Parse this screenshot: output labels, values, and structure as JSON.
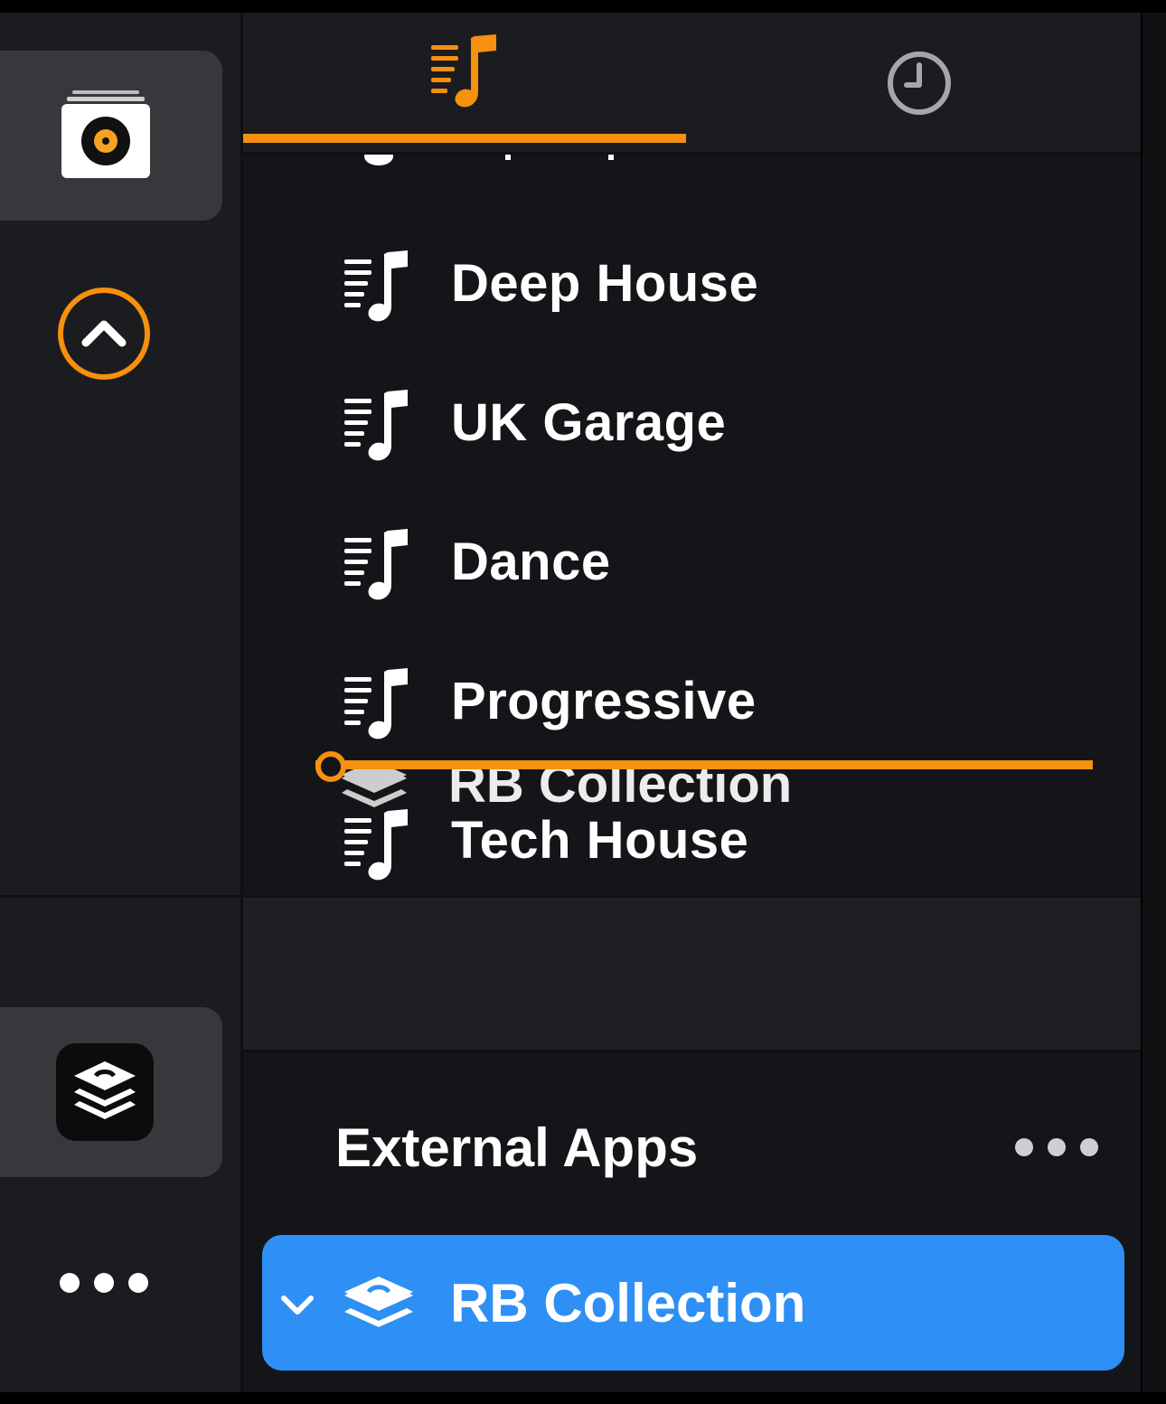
{
  "tabs": [
    {
      "name": "playlists",
      "icon": "playlist-icon",
      "active": true
    },
    {
      "name": "history",
      "icon": "clock-icon",
      "active": false
    }
  ],
  "playlists": {
    "items": [
      {
        "label": "Deep House",
        "icon": "playlist-icon"
      },
      {
        "label": "UK Garage",
        "icon": "playlist-icon"
      },
      {
        "label": "Dance",
        "icon": "playlist-icon"
      },
      {
        "label": "Progressive",
        "icon": "playlist-icon"
      },
      {
        "label": "Tech House",
        "icon": "playlist-icon"
      }
    ],
    "drag": {
      "label": "RB Collection",
      "icon": "layers-icon"
    }
  },
  "external_apps": {
    "title": "External Apps",
    "more_icon": "ellipsis-icon",
    "items": [
      {
        "label": "RB Collection",
        "icon": "layers-icon",
        "expanded": true,
        "selected": true
      }
    ]
  },
  "rail": {
    "top_icon": "record-box-icon",
    "collapse_icon": "chevron-up-circle-icon",
    "bottom_icon": "layers-app-icon",
    "more_icon": "ellipsis-icon"
  },
  "colors": {
    "accent_orange": "#f6900f",
    "selection_blue": "#2e8ff5",
    "panel_bg": "#141518"
  }
}
